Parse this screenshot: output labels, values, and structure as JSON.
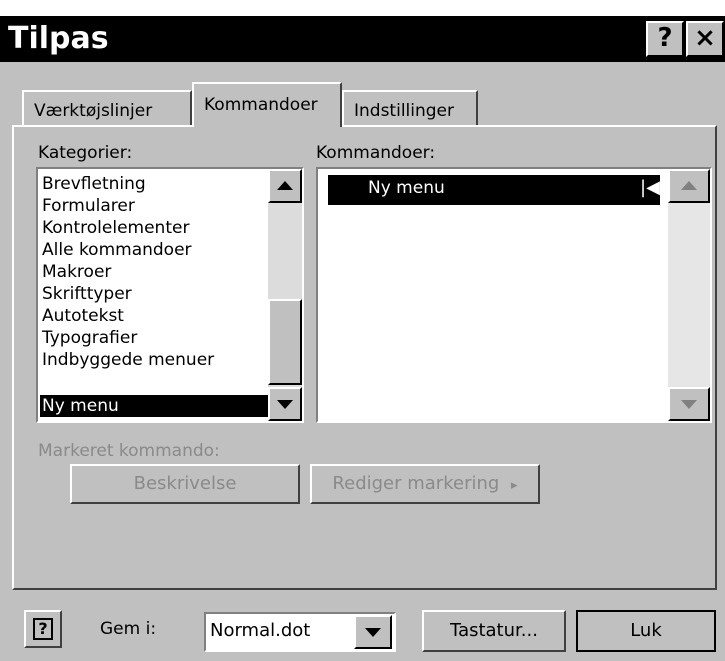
{
  "window": {
    "title": "Tilpas",
    "help_button": "?",
    "close_button": "×"
  },
  "tabs": [
    {
      "label": "Værktøjslinjer"
    },
    {
      "label": "Kommandoer"
    },
    {
      "label": "Indstillinger"
    }
  ],
  "categories": {
    "label": "Kategorier:",
    "items": [
      "Brevfletning",
      "Formularer",
      "Kontrolelementer",
      "Alle kommandoer",
      "Makroer",
      "Skrifttyper",
      "Autotekst",
      "Typografier",
      "Indbyggede menuer",
      "Ny menu"
    ],
    "selected": "Ny menu"
  },
  "commands": {
    "label": "Kommandoer:",
    "items": [
      "Ny menu"
    ],
    "selected": "Ny menu",
    "submenu_marker": "|◀"
  },
  "selected_command": {
    "label": "Markeret kommando:",
    "description_button": "Beskrivelse",
    "modify_button": "Rediger markering",
    "modify_arrow": "▸"
  },
  "footer": {
    "help_icon_glyph": "?",
    "save_in_label": "Gem i:",
    "save_in_value": "Normal.dot",
    "keyboard_button": "Tastatur...",
    "close_button": "Luk"
  },
  "colors": {
    "title_bar": "#000000",
    "dialog_face": "#c0c0c0",
    "selection": "#000000",
    "disabled_text": "#8a8a8a"
  }
}
